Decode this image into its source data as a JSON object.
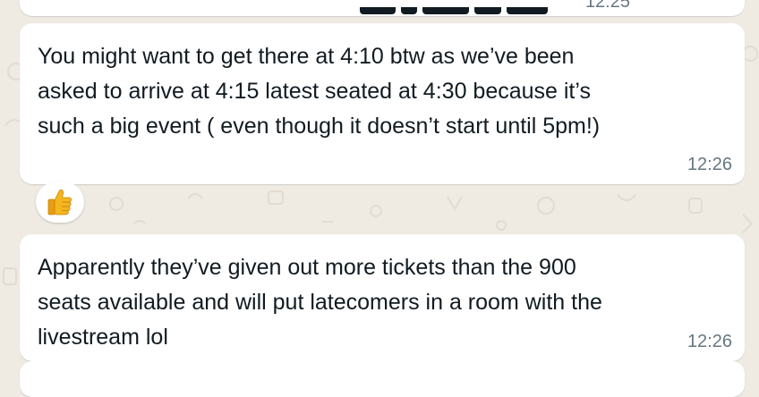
{
  "chat": {
    "previous_message": {
      "time": "12:25"
    },
    "messages": [
      {
        "text": "You might want to get there at 4:10 btw as we’ve been\nasked to arrive at 4:15 latest seated at 4:30 because it’s\nsuch a big event ( even though it doesn’t start until 5pm!)",
        "time": "12:26",
        "reaction": "👍"
      },
      {
        "text": "Apparently they’ve given out more tickets than the 900\nseats available and will put latecomers in a room with the\nlivestream lol",
        "time": "12:26"
      }
    ]
  },
  "colors": {
    "wallpaper": "#efeae2",
    "bubble": "#ffffff",
    "text": "#111b21",
    "timestamp": "#667781"
  },
  "icons": {
    "reaction": "thumbs-up-icon"
  }
}
